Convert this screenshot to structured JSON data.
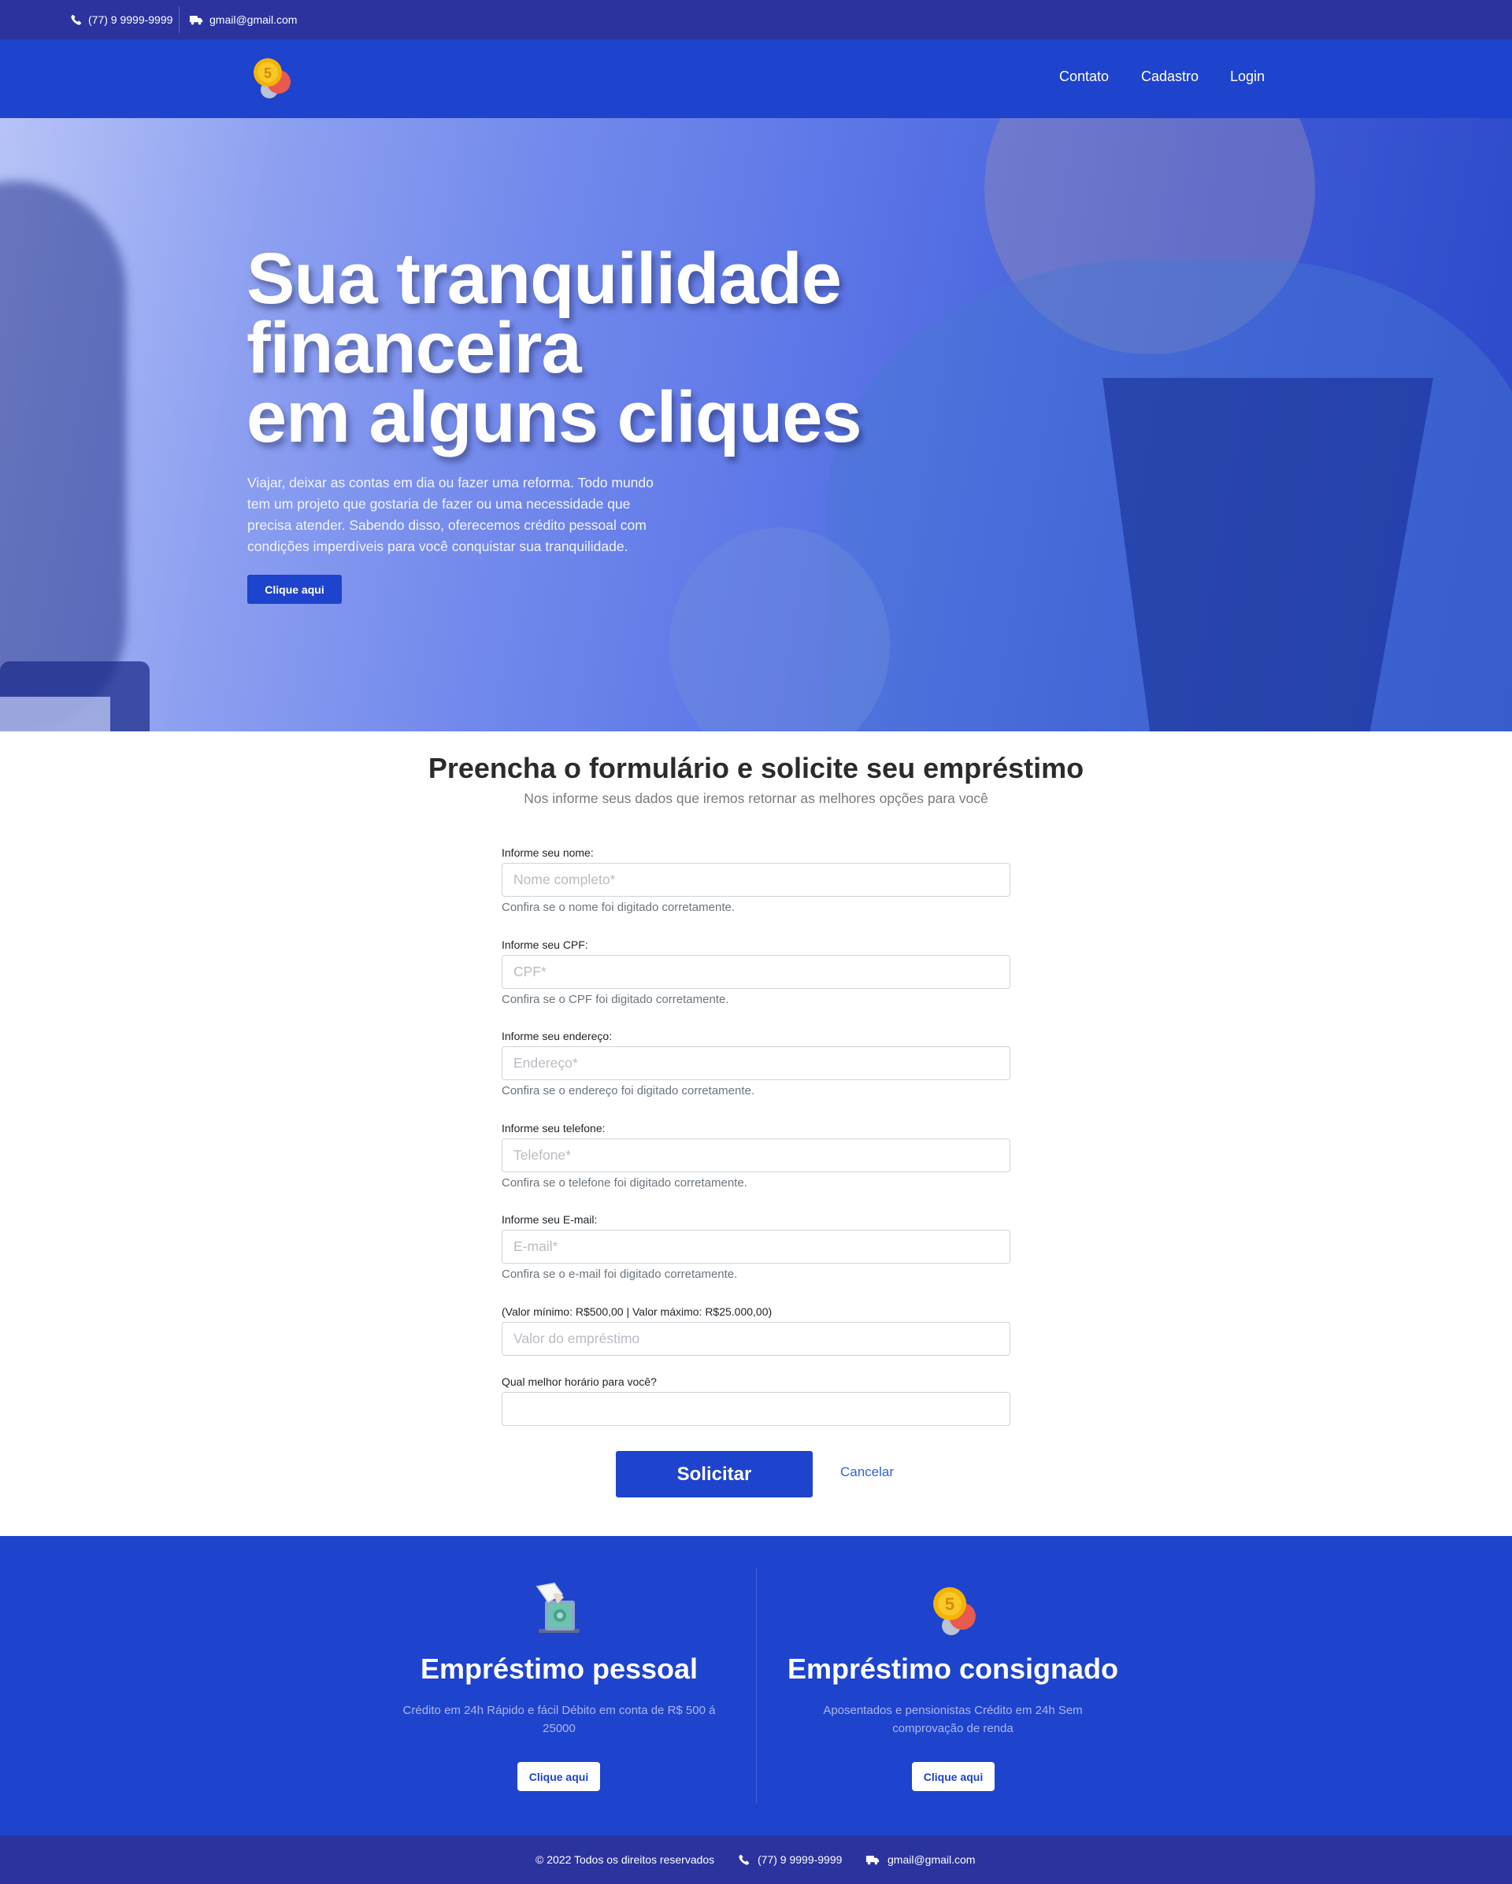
{
  "topbar": {
    "phone": "(77) 9 9999-9999",
    "email": "gmail@gmail.com"
  },
  "nav": {
    "links": [
      "Contato",
      "Cadastro",
      "Login"
    ]
  },
  "hero": {
    "title_lines": [
      "Sua tranquilidade",
      "financeira",
      "em alguns cliques"
    ],
    "description": "Viajar, deixar as contas em dia ou fazer uma reforma. Todo mundo tem um projeto que gostaria de fazer ou uma necessidade que precisa atender. Sabendo disso, oferecemos crédito pessoal com condições imperdíveis para você conquistar sua tranquilidade.",
    "button": "Clique aqui"
  },
  "form": {
    "title": "Preencha o formulário e solicite seu empréstimo",
    "subtitle": "Nos informe seus dados que iremos retornar as melhores opções para você",
    "fields": [
      {
        "label": "Informe seu nome:",
        "placeholder": "Nome completo*",
        "value": "",
        "help": "Confira se o nome foi digitado corretamente."
      },
      {
        "label": "Informe seu CPF:",
        "placeholder": "CPF*",
        "value": "",
        "help": "Confira se o CPF foi digitado corretamente."
      },
      {
        "label": "Informe seu endereço:",
        "placeholder": "Endereço*",
        "value": "",
        "help": "Confira se o endereço foi digitado corretamente."
      },
      {
        "label": "Informe seu telefone:",
        "placeholder": "Telefone*",
        "value": "",
        "help": "Confira se o telefone foi digitado corretamente."
      },
      {
        "label": "Informe seu E-mail:",
        "placeholder": "E-mail*",
        "value": "",
        "help": "Confira se o e-mail foi digitado corretamente."
      },
      {
        "label": "(Valor mínimo: R$500,00 | Valor máximo: R$25.000,00)",
        "placeholder": "Valor do empréstimo",
        "value": ""
      },
      {
        "label": "Qual melhor horário para você?",
        "placeholder": "",
        "value": ""
      }
    ],
    "submit": "Solicitar",
    "cancel": "Cancelar"
  },
  "products": [
    {
      "icon": "loan-document-icon",
      "title": "Empréstimo pessoal",
      "description": "Crédito em 24h Rápido e fácil Débito em conta de R$ 500 á 25000",
      "button": "Clique aqui"
    },
    {
      "icon": "coins-icon",
      "title": "Empréstimo consignado",
      "description": "Aposentados e pensionistas Crédito em 24h Sem comprovação de renda",
      "button": "Clique aqui"
    }
  ],
  "footer": {
    "copyright": "© 2022 Todos os direitos reservados",
    "phone": "(77) 9 9999-9999",
    "email": "gmail@gmail.com"
  },
  "colors": {
    "primary": "#1e43cc",
    "topbar": "#2a339e",
    "link": "#2f63d6"
  }
}
